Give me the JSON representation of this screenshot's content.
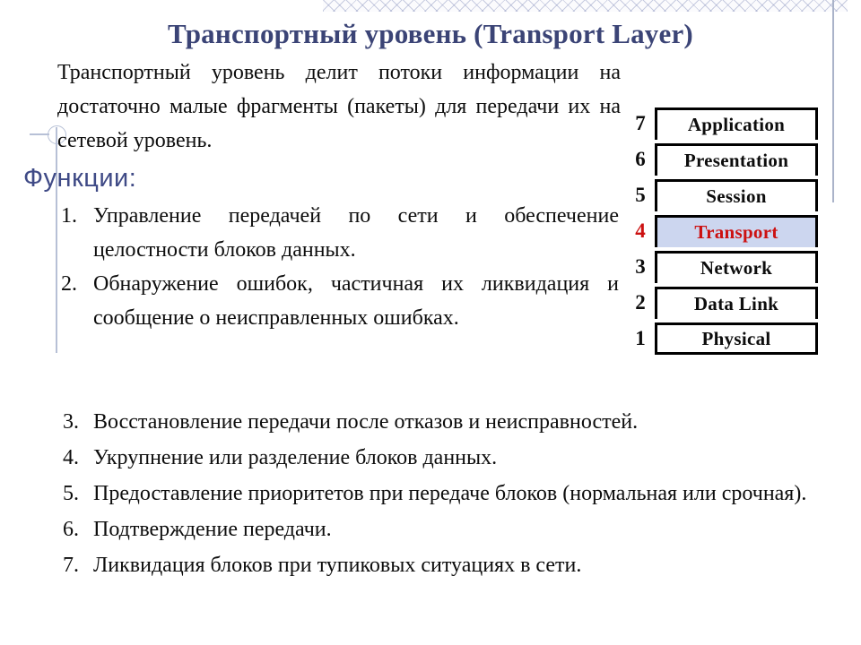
{
  "slide": {
    "title": "Транспортный уровень (Transport Layer)",
    "title_color": "#3b4476",
    "intro": "Транспортный уровень делит потоки информации на достаточно малые фрагменты (пакеты) для передачи их на сетевой уровень.",
    "functions_heading": "Функции:",
    "functions_heading_color": "#3f4a86"
  },
  "functions": [
    {
      "num": "1.",
      "text": "Управление передачей по сети и обеспечение целостности блоков данных."
    },
    {
      "num": "2.",
      "text": "Обнаружение ошибок, частичная их ликвидация и сообщение о неисправленных ошибках."
    },
    {
      "num": "3.",
      "text": "Восстановление передачи после отказов и неисправностей."
    },
    {
      "num": "4.",
      "text": "Укрупнение или разделение блоков данных."
    },
    {
      "num": "5.",
      "text": "Предоставление приоритетов при передаче блоков (нормальная или срочная)."
    },
    {
      "num": "6.",
      "text": "Подтверждение передачи."
    },
    {
      "num": "7.",
      "text": "Ликвидация блоков при тупиковых ситуациях в сети."
    }
  ],
  "osi_stack": {
    "highlight_bg": "#ccd6ef",
    "highlight_text_color": "#cc1111",
    "layers": [
      {
        "number": "7",
        "name": "Application",
        "highlighted": false
      },
      {
        "number": "6",
        "name": "Presentation",
        "highlighted": false
      },
      {
        "number": "5",
        "name": "Session",
        "highlighted": false
      },
      {
        "number": "4",
        "name": "Transport",
        "highlighted": true
      },
      {
        "number": "3",
        "name": "Network",
        "highlighted": false
      },
      {
        "number": "2",
        "name": "Data Link",
        "highlighted": false
      },
      {
        "number": "1",
        "name": "Physical",
        "highlighted": false
      }
    ]
  }
}
